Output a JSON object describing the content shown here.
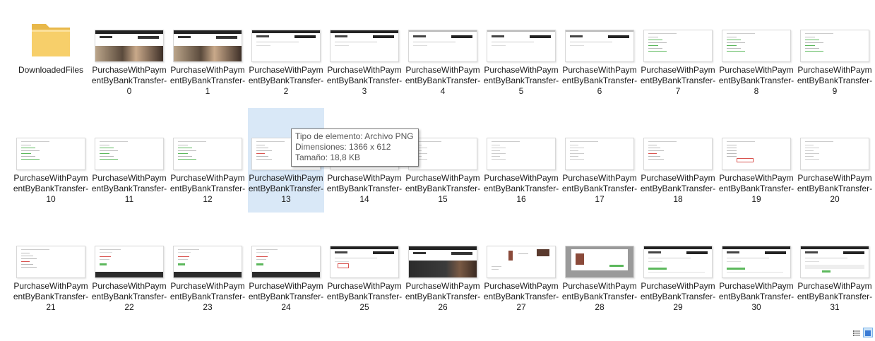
{
  "folder": {
    "name": "DownloadedFiles",
    "icon": "folder-icon"
  },
  "files": [
    {
      "label": "PurchaseWithPaymentByBankTransfer-0",
      "style": "hero"
    },
    {
      "label": "PurchaseWithPaymentByBankTransfer-1",
      "style": "hero"
    },
    {
      "label": "PurchaseWithPaymentByBankTransfer-2",
      "style": "header"
    },
    {
      "label": "PurchaseWithPaymentByBankTransfer-3",
      "style": "header"
    },
    {
      "label": "PurchaseWithPaymentByBankTransfer-4",
      "style": "header-light"
    },
    {
      "label": "PurchaseWithPaymentByBankTransfer-5",
      "style": "header-light"
    },
    {
      "label": "PurchaseWithPaymentByBankTransfer-6",
      "style": "header-light"
    },
    {
      "label": "PurchaseWithPaymentByBankTransfer-7",
      "style": "green-lines"
    },
    {
      "label": "PurchaseWithPaymentByBankTransfer-8",
      "style": "green-lines"
    },
    {
      "label": "PurchaseWithPaymentByBankTransfer-9",
      "style": "green-lines"
    },
    {
      "label": "PurchaseWithPaymentByBankTransfer-10",
      "style": "green-lines"
    },
    {
      "label": "PurchaseWithPaymentByBankTransfer-11",
      "style": "green-lines"
    },
    {
      "label": "PurchaseWithPaymentByBankTransfer-12",
      "style": "green-lines"
    },
    {
      "label": "PurchaseWithPaymentByBankTransfer-13",
      "style": "red-lines"
    },
    {
      "label": "PurchaseWithPaymentByBankTransfer-14",
      "style": "plain"
    },
    {
      "label": "PurchaseWithPaymentByBankTransfer-15",
      "style": "plain"
    },
    {
      "label": "PurchaseWithPaymentByBankTransfer-16",
      "style": "plain"
    },
    {
      "label": "PurchaseWithPaymentByBankTransfer-17",
      "style": "plain"
    },
    {
      "label": "PurchaseWithPaymentByBankTransfer-18",
      "style": "red-lines"
    },
    {
      "label": "PurchaseWithPaymentByBankTransfer-19",
      "style": "red-box"
    },
    {
      "label": "PurchaseWithPaymentByBankTransfer-20",
      "style": "plain"
    },
    {
      "label": "PurchaseWithPaymentByBankTransfer-21",
      "style": "red-lines"
    },
    {
      "label": "PurchaseWithPaymentByBankTransfer-22",
      "style": "green-btn-footer"
    },
    {
      "label": "PurchaseWithPaymentByBankTransfer-23",
      "style": "green-btn-footer"
    },
    {
      "label": "PurchaseWithPaymentByBankTransfer-24",
      "style": "green-btn-footer"
    },
    {
      "label": "PurchaseWithPaymentByBankTransfer-25",
      "style": "header-red"
    },
    {
      "label": "PurchaseWithPaymentByBankTransfer-26",
      "style": "hero-dark"
    },
    {
      "label": "PurchaseWithPaymentByBankTransfer-27",
      "style": "product"
    },
    {
      "label": "PurchaseWithPaymentByBankTransfer-28",
      "style": "modal"
    },
    {
      "label": "PurchaseWithPaymentByBankTransfer-29",
      "style": "header-green"
    },
    {
      "label": "PurchaseWithPaymentByBankTransfer-30",
      "style": "header-green"
    },
    {
      "label": "PurchaseWithPaymentByBankTransfer-31",
      "style": "header-green2"
    }
  ],
  "selected_index": 13,
  "tooltip": {
    "type_line": "Tipo de elemento: Archivo PNG",
    "dimensions_line": "Dimensiones: 1366 x 612",
    "size_line": "Tamaño: 18,8 KB"
  },
  "colors": {
    "selection": "#d9e8f7",
    "folder": "#f5c75a",
    "accent_green": "#5cb85c",
    "accent_red": "#d9534f",
    "dark": "#2b2b2b"
  },
  "view_buttons": {
    "details_icon": "details-view-icon",
    "large_icons_icon": "large-icons-view-icon"
  }
}
